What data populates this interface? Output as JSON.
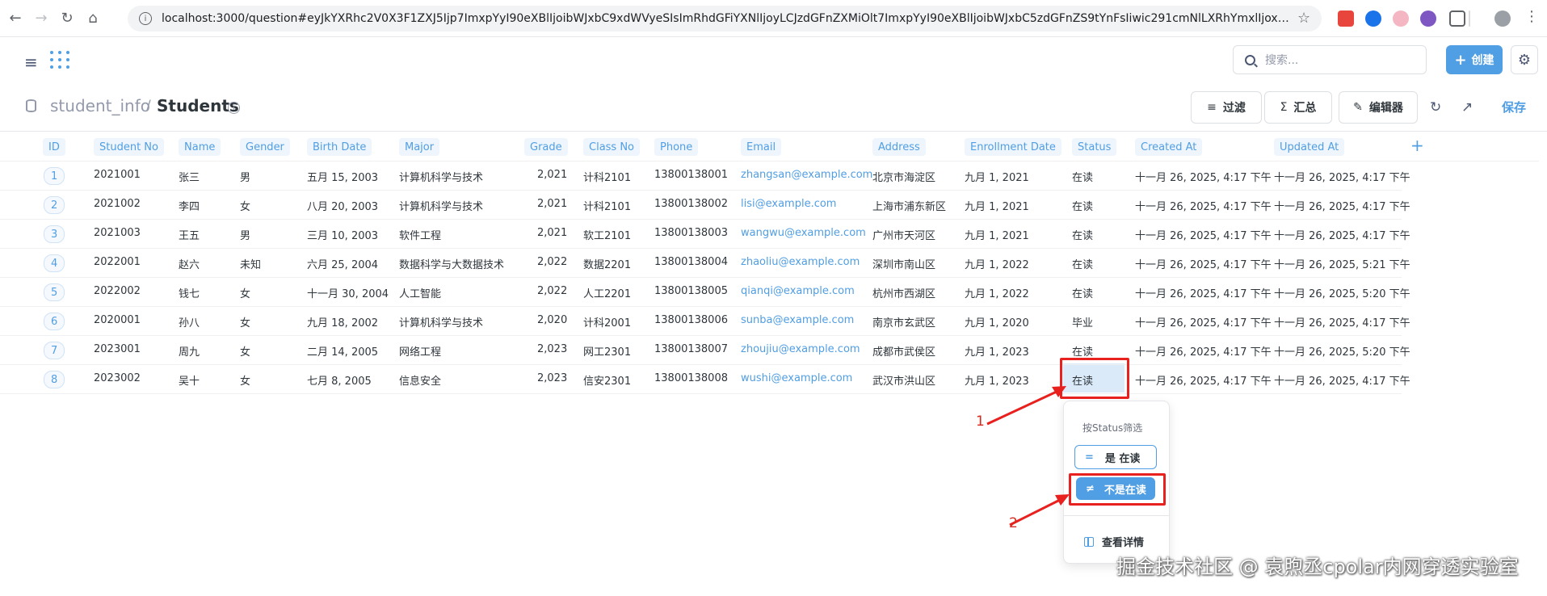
{
  "browser": {
    "url": "localhost:3000/question#eyJkYXRhc2V0X3F1ZXJ5Ijp7ImxpYyI90eXBlIjoibWJxbC9xdWVyeSIsImRhdGFiYXNlIjoyLCJzdGFnZXMiOlt7ImxpYyI90eXBlIjoibWJxbC5zdGFnZS9tYnFsIiwic291cmNlLXRhYmxlIjoxMX1dfSwiZ..."
  },
  "app": {
    "search_placeholder": "搜索...",
    "create_label": "创建"
  },
  "question": {
    "database": "student_info",
    "separator": "/",
    "table": "Students"
  },
  "toolbar": {
    "filter_label": "过滤",
    "summarize_label": "汇总",
    "editor_label": "编辑器",
    "save_label": "保存"
  },
  "table": {
    "columns": [
      "ID",
      "Student No",
      "Name",
      "Gender",
      "Birth Date",
      "Major",
      "Grade",
      "Class No",
      "Phone",
      "Email",
      "Address",
      "Enrollment Date",
      "Status",
      "Created At",
      "Updated At"
    ],
    "rows": [
      [
        "1",
        "2021001",
        "张三",
        "男",
        "五月 15, 2003",
        "计算机科学与技术",
        "2,021",
        "计科2101",
        "13800138001",
        "zhangsan@example.com",
        "北京市海淀区",
        "九月 1, 2021",
        "在读",
        "十一月 26, 2025, 4:17 下午",
        "十一月 26, 2025, 4:17 下午"
      ],
      [
        "2",
        "2021002",
        "李四",
        "女",
        "八月 20, 2003",
        "计算机科学与技术",
        "2,021",
        "计科2101",
        "13800138002",
        "lisi@example.com",
        "上海市浦东新区",
        "九月 1, 2021",
        "在读",
        "十一月 26, 2025, 4:17 下午",
        "十一月 26, 2025, 4:17 下午"
      ],
      [
        "3",
        "2021003",
        "王五",
        "男",
        "三月 10, 2003",
        "软件工程",
        "2,021",
        "软工2101",
        "13800138003",
        "wangwu@example.com",
        "广州市天河区",
        "九月 1, 2021",
        "在读",
        "十一月 26, 2025, 4:17 下午",
        "十一月 26, 2025, 4:17 下午"
      ],
      [
        "4",
        "2022001",
        "赵六",
        "未知",
        "六月 25, 2004",
        "数据科学与大数据技术",
        "2,022",
        "数据2201",
        "13800138004",
        "zhaoliu@example.com",
        "深圳市南山区",
        "九月 1, 2022",
        "在读",
        "十一月 26, 2025, 4:17 下午",
        "十一月 26, 2025, 5:21 下午"
      ],
      [
        "5",
        "2022002",
        "钱七",
        "女",
        "十一月 30, 2004",
        "人工智能",
        "2,022",
        "人工2201",
        "13800138005",
        "qianqi@example.com",
        "杭州市西湖区",
        "九月 1, 2022",
        "在读",
        "十一月 26, 2025, 4:17 下午",
        "十一月 26, 2025, 5:20 下午"
      ],
      [
        "6",
        "2020001",
        "孙八",
        "女",
        "九月 18, 2002",
        "计算机科学与技术",
        "2,020",
        "计科2001",
        "13800138006",
        "sunba@example.com",
        "南京市玄武区",
        "九月 1, 2020",
        "毕业",
        "十一月 26, 2025, 4:17 下午",
        "十一月 26, 2025, 4:17 下午"
      ],
      [
        "7",
        "2023001",
        "周九",
        "女",
        "二月 14, 2005",
        "网络工程",
        "2,023",
        "网工2301",
        "13800138007",
        "zhoujiu@example.com",
        "成都市武侯区",
        "九月 1, 2023",
        "在读",
        "十一月 26, 2025, 4:17 下午",
        "十一月 26, 2025, 5:20 下午"
      ],
      [
        "8",
        "2023002",
        "吴十",
        "女",
        "七月 8, 2005",
        "信息安全",
        "2,023",
        "信安2301",
        "13800138008",
        "wushi@example.com",
        "武汉市洪山区",
        "九月 1, 2023",
        "在读",
        "十一月 26, 2025, 4:17 下午",
        "十一月 26, 2025, 4:17 下午"
      ]
    ]
  },
  "popover": {
    "title": "按Status筛选",
    "eq_symbol": "=",
    "eq_label": "是 在读",
    "neq_symbol": "≠",
    "neq_label": "不是在读",
    "detail_label": "查看详情"
  },
  "annotations": {
    "step1": "1",
    "step2": "2",
    "annotation_color": "#e8201e"
  },
  "watermark": "掘金技术社区 @ 袁煦丞cpolar内网穿透实验室",
  "colors": {
    "brand": "#509ee3",
    "text": "#2e353b",
    "muted": "#949aab"
  }
}
